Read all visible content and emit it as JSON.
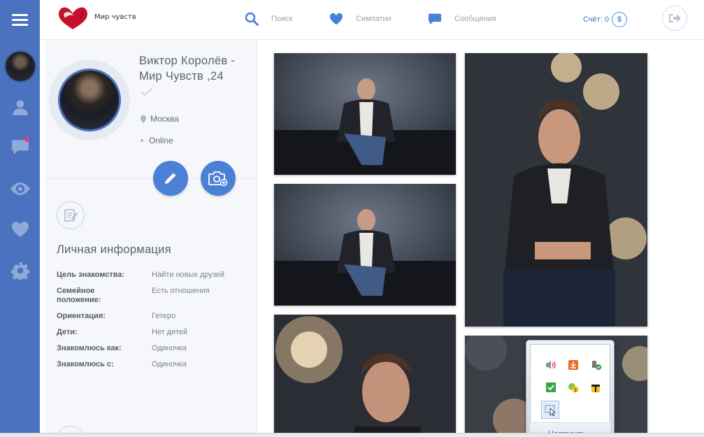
{
  "app": {
    "logo_text": "Мир чувств"
  },
  "nav": {
    "search": "Поиск",
    "sympathies": "Симпатии",
    "messages": "Сообщения",
    "score_label": "Счёт: 0",
    "coin_symbol": "$"
  },
  "sidebar": {
    "items": [
      {
        "icon": "user-icon"
      },
      {
        "icon": "messages-icon",
        "has_badge": true
      },
      {
        "icon": "eye-icon"
      },
      {
        "icon": "heart-icon"
      },
      {
        "icon": "gear-icon"
      }
    ]
  },
  "profile": {
    "name": "Виктор Королёв - Мир Чувств ,24",
    "city": "Москва",
    "status": "Online"
  },
  "info": {
    "title": "Личная информация",
    "rows": [
      {
        "key": "Цель знакомства:",
        "value": "Найти новых друзей"
      },
      {
        "key": "Семейное положение:",
        "value": "Есть отношения"
      },
      {
        "key": "Ориентация:",
        "value": "Гетеро"
      },
      {
        "key": "Дети:",
        "value": "Нет детей"
      },
      {
        "key": "Знакомлюсь как:",
        "value": "Одиночка"
      },
      {
        "key": "Знакомлюсь с:",
        "value": "Одиночка"
      }
    ]
  },
  "tray": {
    "footer_label": "Настроить...",
    "icons": [
      "speaker-icon",
      "update-icon",
      "usb-safe-remove-icon",
      "checkmark-icon",
      "network-icon",
      "gift-icon",
      "screen-capture-icon"
    ]
  },
  "colors": {
    "sidebar": "#4a72bf",
    "accent": "#4a80d6",
    "brand": "#c8102e"
  }
}
